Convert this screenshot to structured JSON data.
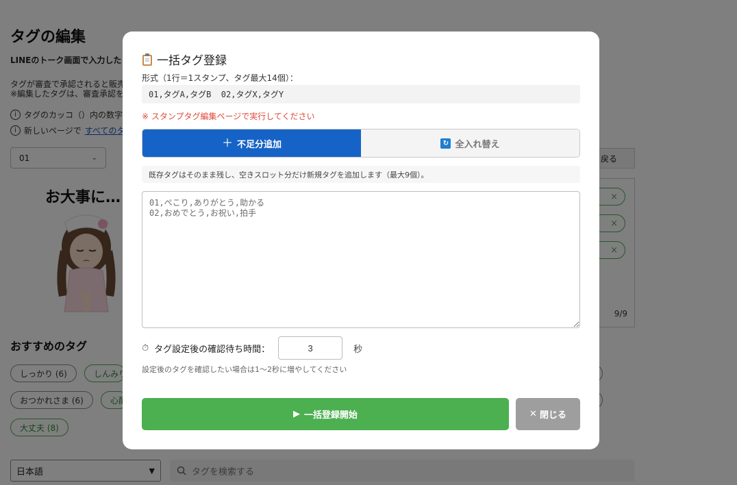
{
  "background": {
    "page_title": "タグの編集",
    "lead": "LINEのトーク画面で入力した",
    "note_line1": "タグが審査で承認されると販売",
    "note_line2": "※編集したタグは、審査承認を",
    "info1": "タグのカッコ（）内の数字",
    "info2_prefix": "新しいページで",
    "info2_link": "すべてのタ",
    "sticker_select_value": "01",
    "back_button": "戻る",
    "tag_count": "9/9",
    "sticker_caption": "お大事に…",
    "recommended_title": "おすすめのタグ",
    "recommended_tags": [
      {
        "label": "しっかり (6)"
      },
      {
        "label": "しんみり"
      },
      {
        "label": "おつかれさま (6)"
      },
      {
        "label": "心配"
      },
      {
        "label": "大丈夫 (8)"
      }
    ],
    "language_select_value": "日本語",
    "search_placeholder": "タグを検索する"
  },
  "modal": {
    "title": "一括タグ登録",
    "format_label": "形式（1行＝1スタンプ、タグ最大14個）：",
    "format_example": "01,タグA,タグB  02,タグX,タグY",
    "warning": "※ スタンプタグ編集ページで実行してください",
    "mode_add_label": "不足分追加",
    "mode_replace_label": "全入れ替え",
    "mode_description": "既存タグはそのまま残し、空きスロット分だけ新規タグを追加します（最大9個）。",
    "textarea_placeholder": "01,ぺこり,ありがとう,助かる\n02,おめでとう,お祝い,拍手",
    "wait_label": "タグ設定後の確認待ち時間：",
    "wait_value": "3",
    "wait_unit": "秒",
    "wait_hint": "設定後のタグを確認したい場合は1〜2秒に増やしてください",
    "start_button": "一括登録開始",
    "close_button": "閉じる"
  },
  "colors": {
    "accent_blue": "#1663c7",
    "start_green": "#4caf50",
    "warning_red": "#e04a3a",
    "close_gray": "#9e9e9e"
  },
  "icons": {
    "title": "clipboard-icon",
    "add_mode": "plus-icon",
    "replace_mode": "refresh-icon",
    "wait": "timer-icon",
    "start": "play-icon",
    "close": "close-icon"
  }
}
